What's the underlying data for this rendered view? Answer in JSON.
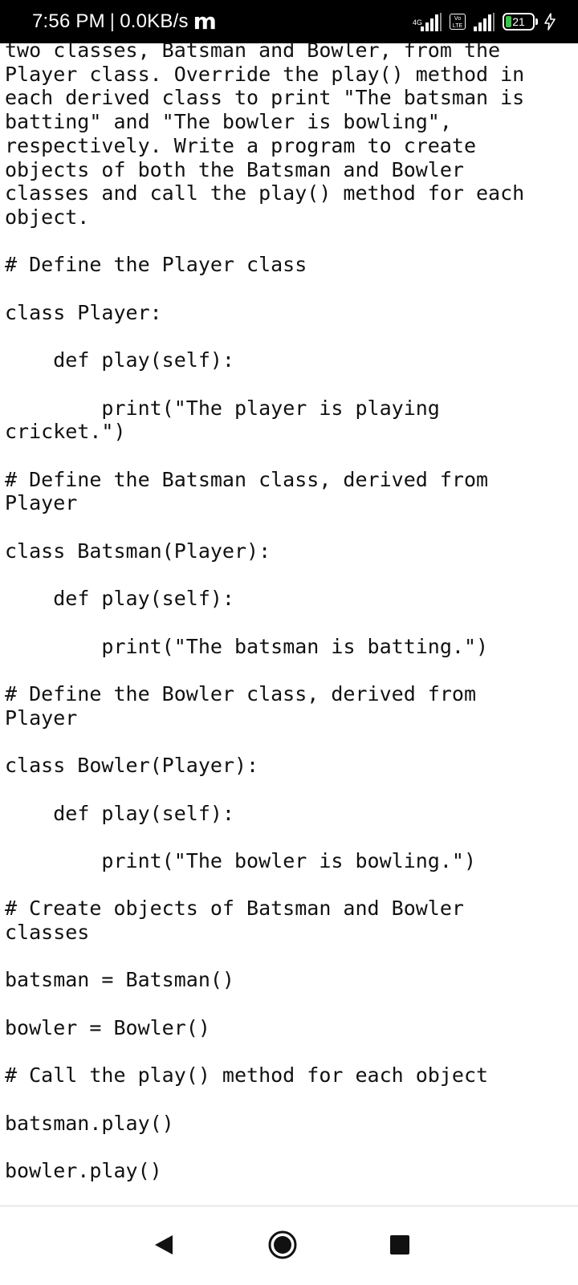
{
  "status_bar": {
    "time": "7:56 PM",
    "separator": "|",
    "net_speed": "0.0KB/s",
    "carrier_logo": "m",
    "network_type": "4G",
    "volte_label": "Vo LTE",
    "battery_level": "21",
    "battery_fraction": 0.21,
    "icons": [
      "signal-icon",
      "volte-icon",
      "signal-icon",
      "battery-icon",
      "charging-icon"
    ]
  },
  "document": {
    "text": "two classes, Batsman and Bowler, from the\nPlayer class. Override the play() method in\neach derived class to print \"The batsman is\nbatting\" and \"The bowler is bowling\",\nrespectively. Write a program to create\nobjects of both the Batsman and Bowler\nclasses and call the play() method for each\nobject.\n\n# Define the Player class\n\nclass Player:\n\n    def play(self):\n\n        print(\"The player is playing\ncricket.\")\n\n# Define the Batsman class, derived from\nPlayer\n\nclass Batsman(Player):\n\n    def play(self):\n\n        print(\"The batsman is batting.\")\n\n# Define the Bowler class, derived from\nPlayer\n\nclass Bowler(Player):\n\n    def play(self):\n\n        print(\"The bowler is bowling.\")\n\n# Create objects of Batsman and Bowler\nclasses\n\nbatsman = Batsman()\n\nbowler = Bowler()\n\n# Call the play() method for each object\n\nbatsman.play()\n\nbowler.play()"
  },
  "nav_bar": {
    "buttons": [
      "back-icon",
      "home-icon",
      "recents-icon"
    ]
  }
}
